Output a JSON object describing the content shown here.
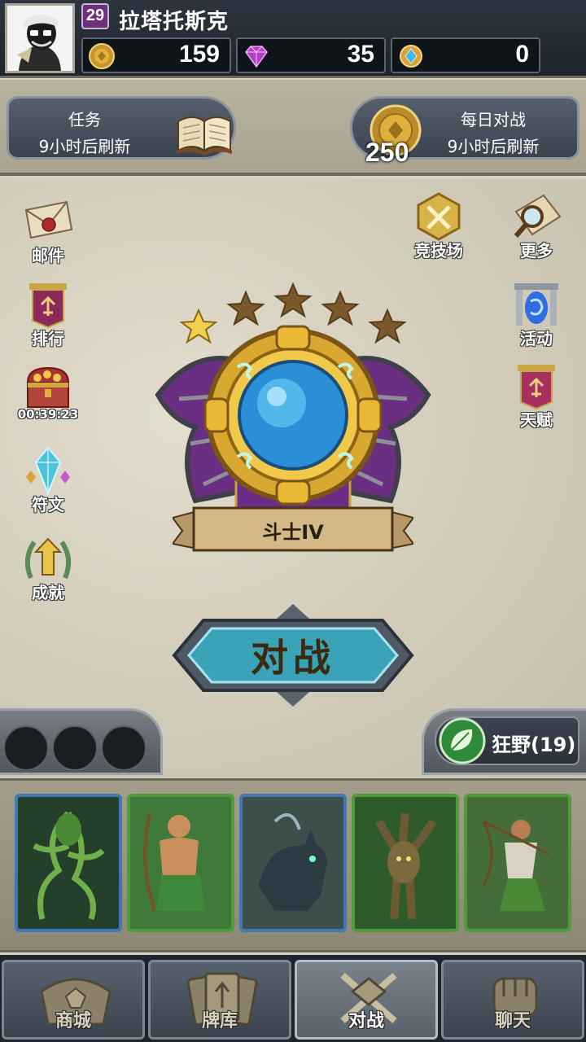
{
  "player": {
    "level": "29",
    "name": "拉塔托斯克"
  },
  "resources": {
    "gold": "159",
    "gems": "35",
    "tokens": "0"
  },
  "banners": {
    "quests_title": "任务",
    "quests_sub": "9小时后刷新",
    "daily_title": "每日对战",
    "daily_sub": "9小时后刷新",
    "daily_reward": "250"
  },
  "side_left": [
    {
      "label": "邮件",
      "icon": "mail-icon"
    },
    {
      "label": "排行",
      "icon": "ranking-banner-icon"
    },
    {
      "label": "00:39:23",
      "icon": "treasure-chest-icon"
    },
    {
      "label": "符文",
      "icon": "rune-crystal-icon"
    },
    {
      "label": "成就",
      "icon": "achievement-laurel-icon"
    }
  ],
  "side_right": [
    {
      "label": "竞技场",
      "icon": "arena-swords-icon"
    },
    {
      "label": "更多",
      "icon": "more-magnifier-icon"
    },
    {
      "label": "活动",
      "icon": "event-portal-icon"
    },
    {
      "label": "天赋",
      "icon": "talent-banner-icon"
    }
  ],
  "rank": {
    "title": "斗士IV",
    "stars_filled": 1,
    "stars_total": 5
  },
  "battle": {
    "label": "对战"
  },
  "deck": {
    "name": "狂野(19)",
    "icon": "leaf-icon"
  },
  "cards": [
    {
      "frame": "blue",
      "art": "vine-creature"
    },
    {
      "frame": "green",
      "art": "archer-hero"
    },
    {
      "frame": "blue",
      "art": "dire-wolf"
    },
    {
      "frame": "green",
      "art": "treant"
    },
    {
      "frame": "green",
      "art": "huntress"
    }
  ],
  "nav": {
    "shop": "商城",
    "deck": "牌库",
    "battle": "对战",
    "chat": "聊天",
    "active": "battle"
  },
  "colors": {
    "gold": "#e2b33a",
    "purple": "#6f2f7d",
    "frame_blue": "#3f79b5",
    "frame_green": "#4f9b3a"
  }
}
